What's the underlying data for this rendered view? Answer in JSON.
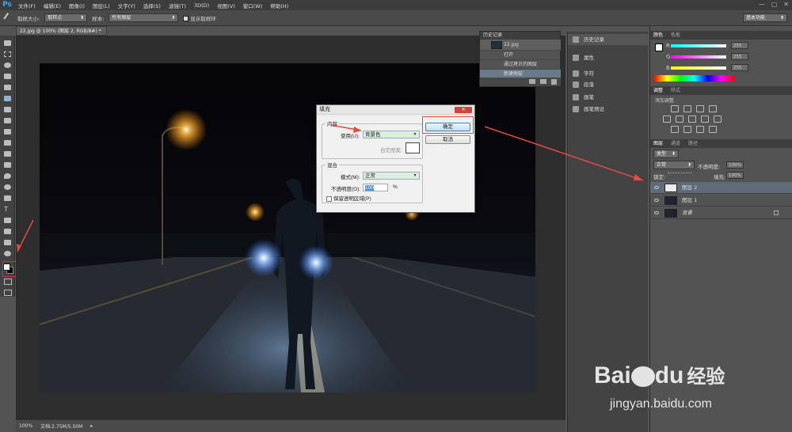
{
  "menubar": {
    "logo": "Ps",
    "items": [
      "文件(F)",
      "编辑(E)",
      "图像(I)",
      "图层(L)",
      "文字(Y)",
      "选择(S)",
      "滤镜(T)",
      "3D(D)",
      "视图(V)",
      "窗口(W)",
      "帮助(H)"
    ],
    "window_controls": [
      "—",
      "▢",
      "✕"
    ]
  },
  "options": {
    "sample_size_label": "取样大小:",
    "sample_size_value": "取样点",
    "sample_label": "样本:",
    "sample_value": "所有图层",
    "show_ring_label": "显示取样环",
    "workspace": "基本功能"
  },
  "document": {
    "tab": "22.jpg @ 100% (图层 2, RGB/8#) *",
    "zoom": "100%",
    "doc_info": "文档:2.75M/5.50M"
  },
  "history_panel": {
    "tab": "历史记录",
    "snapshot": "22.jpg",
    "items": [
      "打开",
      "通过拷贝的图层",
      "新建图层"
    ]
  },
  "side_collapsed": {
    "items": [
      "历史记录",
      "属性",
      "字符",
      "段落",
      "画笔",
      "画笔预设"
    ]
  },
  "color_panel": {
    "tabs": [
      "颜色",
      "色板"
    ],
    "channels": [
      {
        "label": "R",
        "value": "255"
      },
      {
        "label": "G",
        "value": "255"
      },
      {
        "label": "B",
        "value": "255"
      }
    ]
  },
  "adjust_panel": {
    "tabs": [
      "调整",
      "样式"
    ],
    "add_label": "添加调整"
  },
  "layers_panel": {
    "tabs": [
      "图层",
      "通道",
      "路径"
    ],
    "kind": "类型",
    "mode": "正常",
    "opacity_label": "不透明度:",
    "opacity_value": "100%",
    "lock_label": "锁定:",
    "fill_label": "填充:",
    "fill_value": "100%",
    "layers": [
      {
        "name": "图层 2",
        "selected": true
      },
      {
        "name": "图层 1",
        "selected": false
      },
      {
        "name": "背景",
        "selected": false
      }
    ]
  },
  "fill_dialog": {
    "title": "填充",
    "content_group": "内容",
    "use_label": "使用(U):",
    "use_value": "背景色",
    "custom_pattern_label": "自定图案:",
    "blend_group": "混合",
    "mode_label": "模式(M):",
    "mode_value": "正常",
    "opacity_label": "不透明度(O):",
    "opacity_value": "100",
    "opacity_unit": "%",
    "preserve_label": "保留透明区域(P)",
    "ok": "确定",
    "cancel": "取消"
  },
  "watermark": {
    "brand": "Bai",
    "brand2": "du",
    "brand3": "经验",
    "url": "jingyan.baidu.com"
  },
  "colors": {
    "accent": "#31a8ff",
    "annotation": "#e34a44"
  }
}
